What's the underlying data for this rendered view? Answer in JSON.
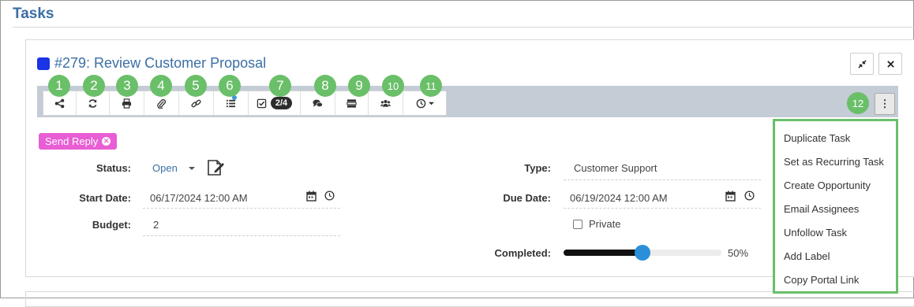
{
  "page": {
    "title": "Tasks"
  },
  "task": {
    "title": "#279: Review Customer Proposal",
    "color": "#1a34e6"
  },
  "window_buttons": [
    {
      "name": "collapse-icon",
      "glyph": "⤡"
    },
    {
      "name": "close-icon",
      "glyph": "✕"
    }
  ],
  "toolbar": {
    "checklist_badge": "2/4",
    "buttons": [
      {
        "name": "share-icon"
      },
      {
        "name": "refresh-icon"
      },
      {
        "name": "print-icon"
      },
      {
        "name": "attachment-icon"
      },
      {
        "name": "link-icon"
      },
      {
        "name": "list-icon"
      },
      {
        "name": "checklist-icon"
      },
      {
        "name": "comments-icon"
      },
      {
        "name": "details-icon"
      },
      {
        "name": "users-icon"
      },
      {
        "name": "clock-icon"
      }
    ]
  },
  "callouts": [
    "1",
    "2",
    "3",
    "4",
    "5",
    "6",
    "7",
    "8",
    "9",
    "10",
    "11",
    "12"
  ],
  "more_button": {
    "glyph": "⋮"
  },
  "tag": {
    "label": "Send Reply",
    "color": "#e85ed4"
  },
  "fields": {
    "status_label": "Status:",
    "status_value": "Open",
    "start_label": "Start Date:",
    "start_value": "06/17/2024 12:00 AM",
    "budget_label": "Budget:",
    "budget_value": "2",
    "type_label": "Type:",
    "type_value": "Customer Support",
    "due_label": "Due Date:",
    "due_value": "06/19/2024 12:00 AM",
    "private_label": "Private",
    "completed_label": "Completed:",
    "completed_value": "50%",
    "completed_fraction": 0.5
  },
  "menu": {
    "items": [
      "Duplicate Task",
      "Set as Recurring Task",
      "Create Opportunity",
      "Email Assignees",
      "Unfollow Task",
      "Add Label",
      "Copy Portal Link"
    ]
  },
  "colors": {
    "accent": "#3b6ea5",
    "callout": "#6abf69",
    "slider": "#2a8fd8"
  }
}
